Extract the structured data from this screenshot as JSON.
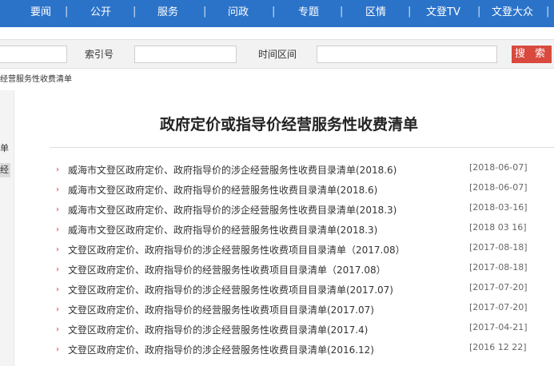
{
  "nav": {
    "items": [
      "要闻",
      "公开",
      "服务",
      "问政",
      "专题",
      "区情",
      "文登TV",
      "文登大众"
    ]
  },
  "search": {
    "index_label": "索引号",
    "time_label": "时间区间",
    "button_label": "搜 索"
  },
  "breadcrumb": "经营服务性收费清单",
  "left": {
    "item1": "单",
    "item2": "经"
  },
  "page": {
    "title": "政府定价或指导价经营服务性收费清单"
  },
  "list": [
    {
      "title": "威海市文登区政府定价、政府指导价的涉企经营服务性收费目录清单(2018.6)",
      "date": "[2018-06-07]"
    },
    {
      "title": "威海市文登区政府定价、政府指导价的经营服务性收费目录清单(2018.6)",
      "date": "[2018-06-07]"
    },
    {
      "title": "威海市文登区政府定价、政府指导价的涉企经营服务性收费目录清单(2018.3)",
      "date": "[2018-03-16]"
    },
    {
      "title": "威海市文登区政府定价、政府指导价的经营服务性收费目录清单(2018.3)",
      "date": "[2018 03 16]"
    },
    {
      "title": "文登区政府定价、政府指导价的涉企经营服务性收费项目目录清单（2017.08）",
      "date": "[2017-08-18]"
    },
    {
      "title": "文登区政府定价、政府指导价的经营服务性收费项目目录清单（2017.08）",
      "date": "[2017-08-18]"
    },
    {
      "title": "文登区政府定价、政府指导价的涉企经营服务性收费项目目录清单(2017.07)",
      "date": "[2017-07-20]"
    },
    {
      "title": "文登区政府定价、政府指导价的经营服务性收费项目目录清单(2017.07)",
      "date": "[2017-07-20]"
    },
    {
      "title": "文登区政府定价、政府指导价的涉企经营服务性收费目录清单(2017.4)",
      "date": "[2017-04-21]"
    },
    {
      "title": "文登区政府定价、政府指导价的涉企经营服务性收费目录清单(2016.12)",
      "date": "[2016 12 22]"
    }
  ],
  "colors": {
    "nav_bg": "#2b73c9",
    "search_button": "#d9493e",
    "bullet": "#d33333"
  }
}
